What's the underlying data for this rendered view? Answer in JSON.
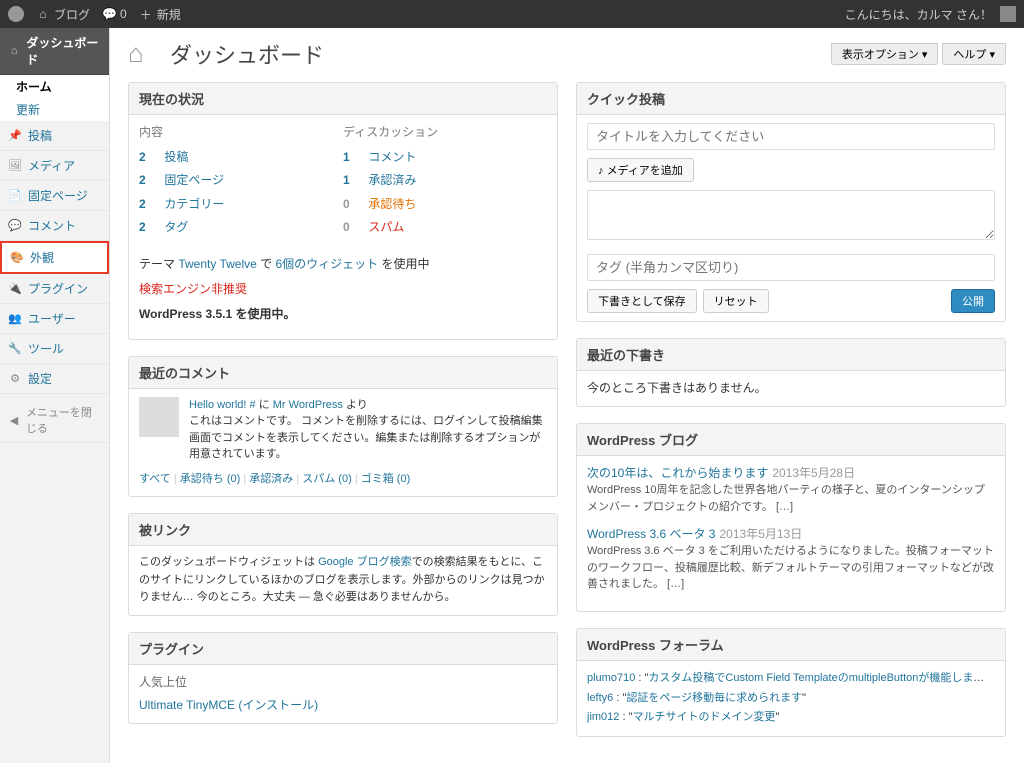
{
  "adminbar": {
    "site": "ブログ",
    "comment_count": "0",
    "new": "新規",
    "greeting": "こんにちは、カルマ さん！"
  },
  "screen": {
    "options": "表示オプション ▾",
    "help": "ヘルプ ▾"
  },
  "sidebar": {
    "dashboard": "ダッシュボード",
    "home": "ホーム",
    "updates": "更新",
    "posts": "投稿",
    "media": "メディア",
    "pages": "固定ページ",
    "comments": "コメント",
    "appearance": "外観",
    "plugins": "プラグイン",
    "users": "ユーザー",
    "tools": "ツール",
    "settings": "設定",
    "collapse": "メニューを閉じる"
  },
  "page_title": "ダッシュボード",
  "right_now": {
    "title": "現在の状況",
    "content_h": "内容",
    "discussion_h": "ディスカッション",
    "rows": [
      {
        "cn": "2",
        "cl": "投稿",
        "dn": "1",
        "dl": "コメント",
        "dclass": ""
      },
      {
        "cn": "2",
        "cl": "固定ページ",
        "dn": "1",
        "dl": "承認済み",
        "dclass": ""
      },
      {
        "cn": "2",
        "cl": "カテゴリー",
        "dn": "0",
        "dl": "承認待ち",
        "dclass": "pending"
      },
      {
        "cn": "2",
        "cl": "タグ",
        "dn": "0",
        "dl": "スパム",
        "dclass": "spam"
      }
    ],
    "theme_pre": "テーマ ",
    "theme": "Twenty Twelve",
    "theme_mid": " で ",
    "widgets": "6個のウィジェット",
    "theme_post": " を使用中",
    "seo": "検索エンジン非推奨",
    "version": "WordPress 3.5.1 を使用中。"
  },
  "recent_comments": {
    "title": "最近のコメント",
    "post": "Hello world! #",
    "glue": " に ",
    "author": "Mr WordPress",
    "from": " より",
    "text": "これはコメントです。 コメントを削除するには、ログインして投稿編集画面でコメントを表示してください。編集または削除するオプションが用意されています。",
    "filters": {
      "all": "すべて",
      "pending": "承認待ち (0)",
      "approved": "承認済み",
      "spam": "スパム (0)",
      "trash": "ゴミ箱 (0)"
    }
  },
  "incoming": {
    "title": "被リンク",
    "text_pre": "このダッシュボードウィジェットは ",
    "link": "Google ブログ検索",
    "text_post": "での検索結果をもとに、このサイトにリンクしているほかのブログを表示します。外部からのリンクは見つかりません… 今のところ。大丈夫 — 急ぐ必要はありませんから。"
  },
  "plugins_w": {
    "title": "プラグイン",
    "popular": "人気上位",
    "plugin": "Ultimate TinyMCE",
    "install": " (インストール)"
  },
  "quick_press": {
    "title": "クイック投稿",
    "title_ph": "タイトルを入力してください",
    "media": "メディアを追加",
    "tags_ph": "タグ (半角カンマ区切り)",
    "save": "下書きとして保存",
    "reset": "リセット",
    "publish": "公開"
  },
  "drafts": {
    "title": "最近の下書き",
    "empty": "今のところ下書きはありません。"
  },
  "wp_blog": {
    "title": "WordPress ブログ",
    "items": [
      {
        "t": "次の10年は、これから始まります",
        "d": "2013年5月28日",
        "b": "WordPress 10周年を記念した世界各地パーティの様子と、夏のインターンシップメンバー・プロジェクトの紹介です。 […]"
      },
      {
        "t": "WordPress 3.6 ベータ 3",
        "d": "2013年5月13日",
        "b": "WordPress 3.6 ベータ 3 をご利用いただけるようになりました。投稿フォーマットのワークフロー、投稿履歴比較、新デフォルトテーマの引用フォーマットなどが改善されました。 […]"
      }
    ]
  },
  "wp_forum": {
    "title": "WordPress フォーラム",
    "items": [
      {
        "u": "plumo710",
        "t": "カスタム投稿でCustom Field TemplateのmultipleButtonが機能しません。"
      },
      {
        "u": "lefty6",
        "t": "認証をページ移動毎に求められます"
      },
      {
        "u": "jim012",
        "t": "マルチサイトのドメイン変更"
      }
    ]
  }
}
